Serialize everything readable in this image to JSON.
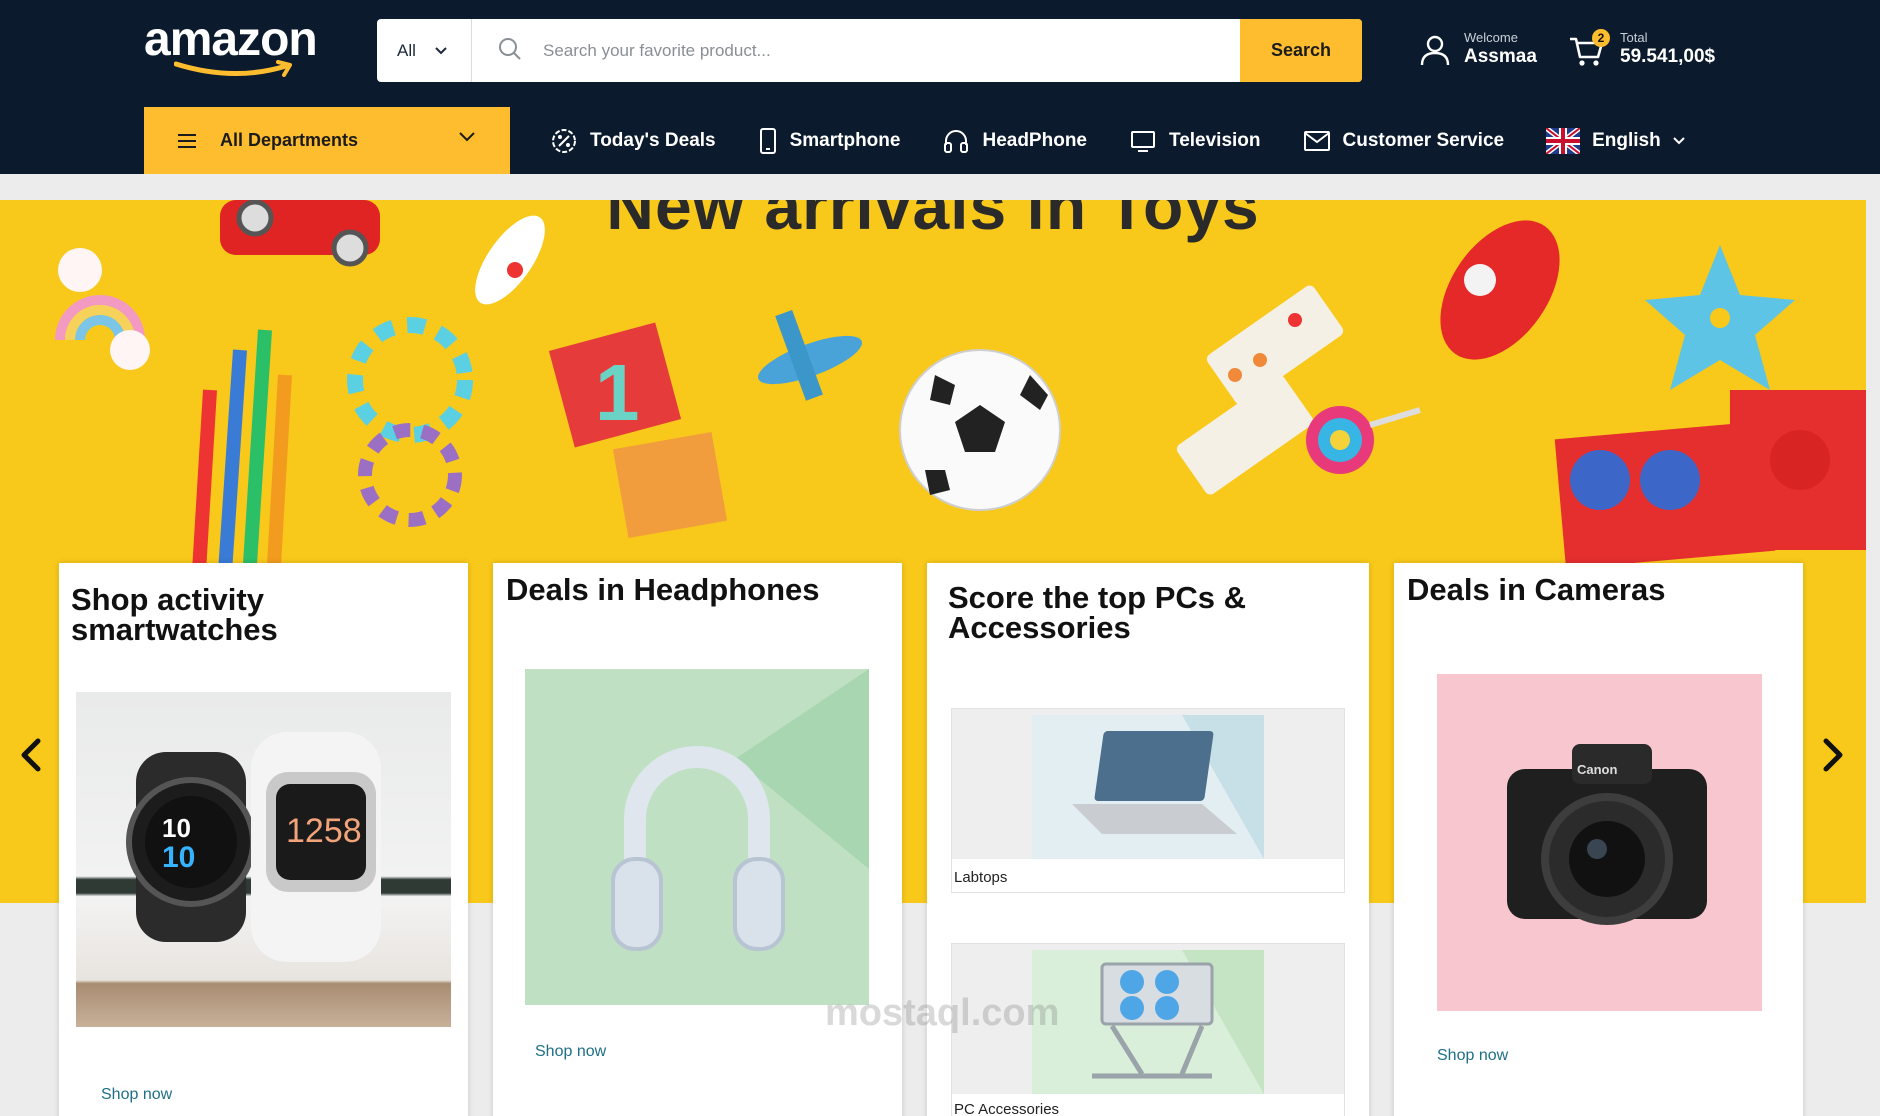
{
  "header": {
    "logo_text": "amazon",
    "search": {
      "category": "All",
      "placeholder": "Search your favorite product...",
      "button_label": "Search"
    },
    "user": {
      "welcome_label": "Welcome",
      "name": "Assmaa"
    },
    "cart": {
      "count": "2",
      "total_label": "Total",
      "total_value": "59.541,00$"
    }
  },
  "nav": {
    "departments_label": "All Departments",
    "items": [
      {
        "label": "Today's Deals",
        "icon": "percent-badge-icon"
      },
      {
        "label": "Smartphone",
        "icon": "smartphone-icon"
      },
      {
        "label": "HeadPhone",
        "icon": "headphone-icon"
      },
      {
        "label": "Television",
        "icon": "television-icon"
      },
      {
        "label": "Customer Service",
        "icon": "envelope-icon"
      }
    ],
    "language": "English"
  },
  "banner": {
    "title": "New arrivals in Toys"
  },
  "cards": [
    {
      "title": "Shop activity smartwatches",
      "link": "Shop now"
    },
    {
      "title": "Deals in Headphones",
      "link": "Shop now"
    },
    {
      "title": "Score the top PCs & Accessories",
      "tiles": [
        "Labtops",
        "PC Accessories"
      ]
    },
    {
      "title": "Deals in Cameras",
      "link": "Shop now"
    }
  ],
  "watermark": "mostaql.com",
  "colors": {
    "header_bg": "#0b1a2c",
    "accent": "#febd2e",
    "banner": "#f8c81a"
  }
}
